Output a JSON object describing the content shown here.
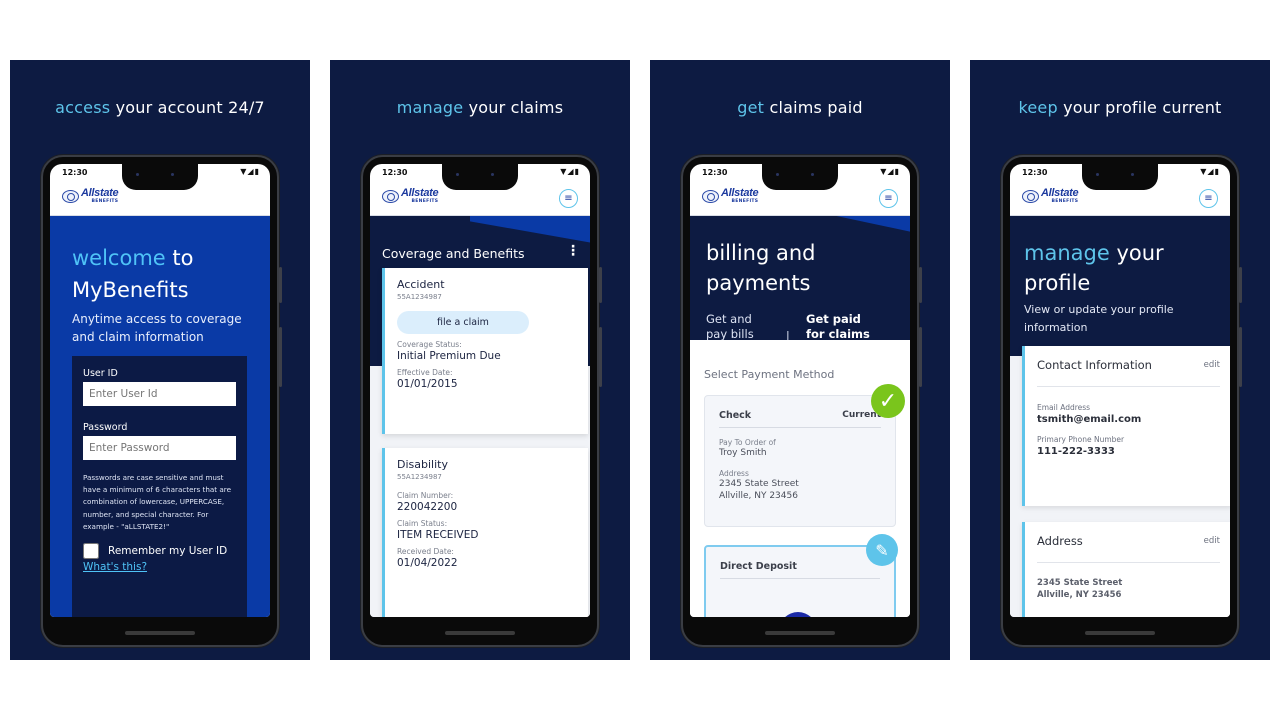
{
  "status_bar": {
    "time": "12:30",
    "icons": "▼◢▮"
  },
  "brand": {
    "name": "Allstate",
    "sub": "BENEFITS"
  },
  "panels": [
    {
      "heading_accent": "access",
      "heading_rest": " your account 24/7",
      "screen": {
        "title_accent": "welcome",
        "title_rest1": " to",
        "title_line2": "MyBenefits",
        "subtitle": "Anytime access to coverage and claim information",
        "user_id_label": "User ID",
        "user_id_placeholder": "Enter User Id",
        "password_label": "Password",
        "password_placeholder": "Enter Password",
        "password_help": "Passwords are case sensitive and must have a minimum of 6 characters that are combination of lowercase, UPPERCASE, number, and special character. For example - \"aLLSTATE2!\"",
        "remember_label": "Remember my User ID",
        "whats_this": "What's this?"
      }
    },
    {
      "heading_accent": "manage",
      "heading_rest": " your claims",
      "screen": {
        "section_title": "Coverage and Benefits",
        "cards": [
          {
            "title": "Accident",
            "id": "55A1234987",
            "action": "file a claim",
            "fields": [
              {
                "label": "Coverage Status:",
                "value": "Initial Premium Due"
              },
              {
                "label": "Effective Date:",
                "value": "01/01/2015"
              }
            ]
          },
          {
            "title": "Disability",
            "id": "55A1234987",
            "fields": [
              {
                "label": "Claim Number:",
                "value": "220042200"
              },
              {
                "label": "Claim Status:",
                "value": "ITEM RECEIVED"
              },
              {
                "label": "Received Date:",
                "value": "01/04/2022"
              }
            ]
          }
        ]
      }
    },
    {
      "heading_accent": "get",
      "heading_rest": " claims paid",
      "screen": {
        "title_line1": "billing and",
        "title_line2": "payments",
        "tabs": [
          {
            "line1": "Get and",
            "line2": "pay bills",
            "active": false
          },
          {
            "line1": "Get paid",
            "line2": "for claims",
            "active": true
          }
        ],
        "tab_divider": "|",
        "section_label": "Select Payment Method",
        "methods": [
          {
            "title": "Check",
            "status": "Current",
            "pay_to_label": "Pay To Order of",
            "pay_to_value": "Troy Smith",
            "address_label": "Address",
            "address_line1": "2345 State Street",
            "address_line2": "Allville, NY 23456"
          },
          {
            "title": "Direct Deposit"
          }
        ]
      }
    },
    {
      "heading_accent": "keep",
      "heading_rest": " your profile current",
      "screen": {
        "title_accent": "manage",
        "title_rest": " your",
        "title_line2": "profile",
        "subtitle": "View or update your profile information",
        "contact": {
          "title": "Contact Information",
          "edit": "edit",
          "email_label": "Email Address",
          "email_value": "tsmith@email.com",
          "phone_label": "Primary Phone Number",
          "phone_value": "111-222-3333"
        },
        "address": {
          "title": "Address",
          "edit": "edit",
          "line1": "2345 State Street",
          "line2": "Allville, NY 23456"
        }
      }
    }
  ],
  "colors": {
    "panel_bg": "#0d1b42",
    "accent_cyan": "#5ec4ea",
    "brand_blue": "#0a3aa6",
    "success_green": "#7ac51c"
  }
}
